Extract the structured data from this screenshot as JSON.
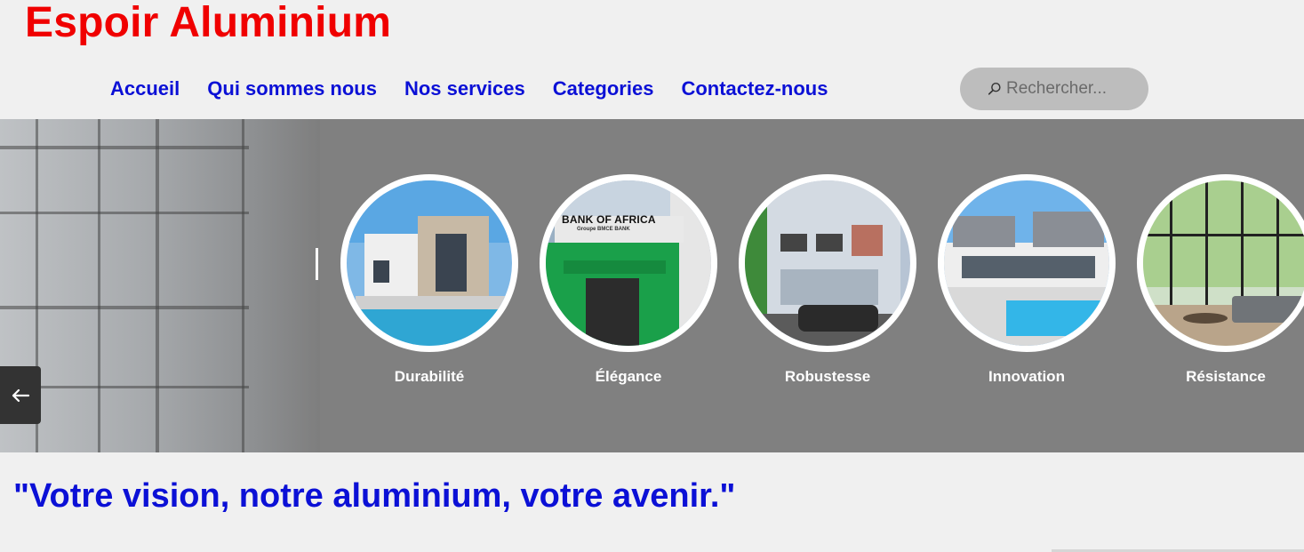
{
  "site": {
    "title": "Espoir Aluminium"
  },
  "nav": {
    "items": [
      {
        "label": "Accueil"
      },
      {
        "label": "Qui sommes nous"
      },
      {
        "label": "Nos services"
      },
      {
        "label": "Categories"
      },
      {
        "label": "Contactez-nous"
      }
    ]
  },
  "search": {
    "placeholder": "Rechercher...",
    "icon": "search-icon"
  },
  "hero": {
    "prev_icon": "arrow-left-icon",
    "slides": [
      {
        "label": "Durabilité",
        "icon": "modern-house-pool-image"
      },
      {
        "label": "Élégance",
        "icon": "bank-of-africa-building-image"
      },
      {
        "label": "Robustesse",
        "icon": "apartment-building-image"
      },
      {
        "label": "Innovation",
        "icon": "villa-pool-image"
      },
      {
        "label": "Résistance",
        "icon": "glass-living-room-image"
      }
    ],
    "bank_sign_top": "BANK OF AFRICA",
    "bank_sign_sub": "Groupe BMCE BANK"
  },
  "tagline": "\"Votre vision, notre aluminium, votre avenir.\"",
  "colors": {
    "title": "#f00000",
    "nav": "#0b10d6",
    "hero_bg": "#808080",
    "search_bg": "#bdbdbd"
  }
}
